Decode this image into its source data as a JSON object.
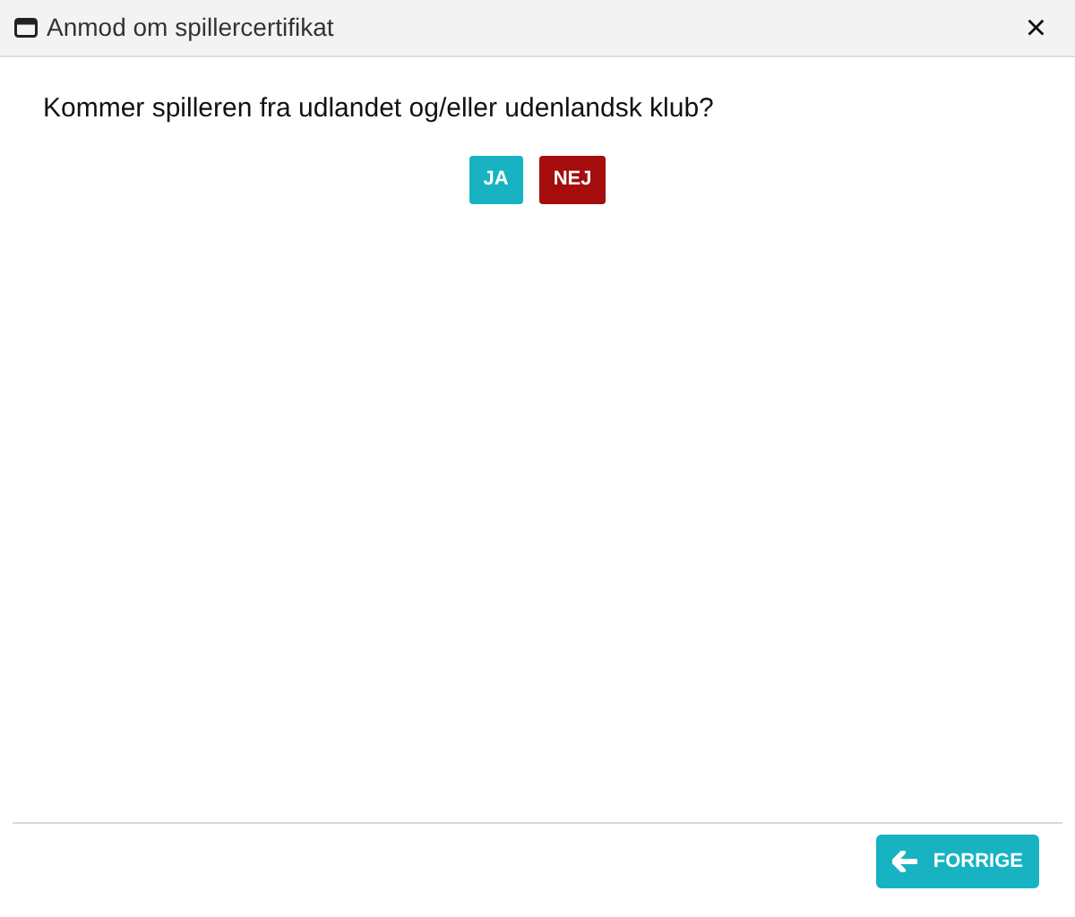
{
  "window": {
    "title": "Anmod om spillercertifikat",
    "close": "×"
  },
  "question": "Kommer spilleren fra udlandet og/eller udenlandsk klub?",
  "answers": [
    {
      "label": "JA",
      "kind": "yes"
    },
    {
      "label": "NEJ",
      "kind": "no"
    }
  ],
  "footer": {
    "back_button": "FORRIGE"
  }
}
